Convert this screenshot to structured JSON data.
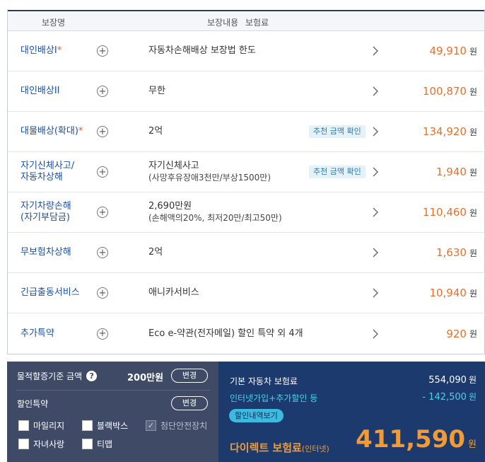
{
  "table": {
    "headers": [
      "보장명",
      "보장내용",
      "보험료"
    ],
    "rows": [
      {
        "name": "대인배상I",
        "required": "*",
        "desc": "자동차손해배상 보장법 한도",
        "desc_sub": "",
        "badge": "",
        "price": "49,910",
        "unit": "원"
      },
      {
        "name": "대인배상II",
        "required": "",
        "desc": "무한",
        "desc_sub": "",
        "badge": "",
        "price": "100,870",
        "unit": "원"
      },
      {
        "name": "대물배상(확대)",
        "required": "*",
        "desc": "2억",
        "desc_sub": "",
        "badge": "추천 금액 확인",
        "price": "134,920",
        "unit": "원"
      },
      {
        "name": "자기신체사고/",
        "name2": "자동차상해",
        "required": "",
        "desc": "자기신체사고",
        "desc_sub": "(사망후유장애3천만/부상1500만)",
        "badge": "추천 금액 확인",
        "price": "1,940",
        "unit": "원"
      },
      {
        "name": "자기차량손해",
        "name2": "(자기부담금)",
        "required": "",
        "desc": "2,690만원",
        "desc_sub": "(손해액의20%, 최저20만/최고50만)",
        "badge": "",
        "price": "110,460",
        "unit": "원"
      },
      {
        "name": "무보험차상해",
        "required": "",
        "desc": "2억",
        "desc_sub": "",
        "badge": "",
        "price": "1,630",
        "unit": "원"
      },
      {
        "name": "긴급출동서비스",
        "required": "",
        "desc": "애니카서비스",
        "desc_sub": "",
        "badge": "",
        "price": "10,940",
        "unit": "원"
      },
      {
        "name": "추가특약",
        "required": "",
        "desc": "Eco e-약관(전자메일) 할인 특약 외 4개",
        "desc_sub": "",
        "badge": "",
        "price": "920",
        "unit": "원"
      }
    ]
  },
  "options": {
    "damage_label": "물적할증기준 금액",
    "damage_amount": "200만원",
    "change_label": "변경",
    "discount_label": "할인특약",
    "checkboxes": [
      "마일리지",
      "블랙박스",
      "첨단안전장치",
      "자녀사랑",
      "티맵"
    ]
  },
  "summary": {
    "base_label": "기본 자동차 보험료",
    "base_value": "554,090",
    "discount_label": "인터넷가입+추가할인 등",
    "discount_value": "- 142,500",
    "unit": "원",
    "discount_button": "할인내역보기",
    "direct_label": "다이렉트 보험료",
    "direct_suffix": "(인터넷)",
    "total": "411,590"
  },
  "colors": {
    "accent": "#e8702a",
    "name_blue": "#1d4fa0",
    "left_panel": "#3f4b66",
    "right_panel": "#1c3a6e",
    "cyan": "#4fd0e8",
    "orange_total": "#f29a33"
  }
}
